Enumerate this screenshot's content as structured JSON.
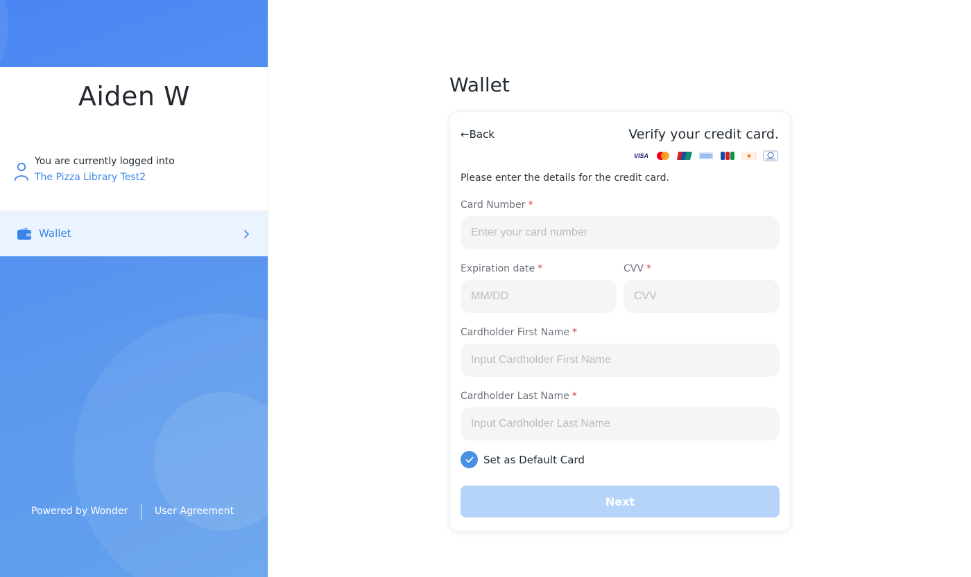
{
  "sidebar": {
    "user_name": "Aiden W",
    "logged_in_text": "You are currently logged into",
    "organization": "The Pizza Library Test2",
    "nav_items": [
      {
        "label": "Wallet",
        "icon": "wallet-icon",
        "active": true
      }
    ],
    "footer": {
      "powered_by": "Powered by Wonder",
      "user_agreement": "User Agreement"
    }
  },
  "main": {
    "title": "Wallet",
    "card": {
      "back_label": "Back",
      "heading": "Verify your credit card.",
      "card_brands": [
        {
          "name": "VISA",
          "color": "#1a1f71"
        },
        {
          "name": "mastercard",
          "color": "#eb001b"
        },
        {
          "name": "UnionPay",
          "color": "#d71e28"
        },
        {
          "name": "AMEX",
          "color": "#8fb0e6"
        },
        {
          "name": "JCB",
          "color": "#0b4ea2"
        },
        {
          "name": "DISCOVER",
          "color": "#f08a24"
        },
        {
          "name": "Diners Club",
          "color": "#2e5aa8"
        }
      ],
      "intro": "Please enter the details for the credit card.",
      "fields": {
        "card_number": {
          "label": "Card Number",
          "placeholder": "Enter your card number",
          "value": ""
        },
        "expiration": {
          "label": "Expiration date",
          "placeholder": "MM/DD",
          "value": ""
        },
        "cvv": {
          "label": "CVV",
          "placeholder": "CVV",
          "value": ""
        },
        "first_name": {
          "label": "Cardholder First Name",
          "placeholder": "Input Cardholder First Name",
          "value": ""
        },
        "last_name": {
          "label": "Cardholder Last Name",
          "placeholder": "Input Cardholder Last Name",
          "value": ""
        }
      },
      "required_marker": "*",
      "default_card": {
        "label": "Set as Default Card",
        "checked": true
      },
      "next_label": "Next"
    }
  },
  "colors": {
    "accent": "#3a86e8",
    "sidebar_gradient_start": "#4a86f3",
    "sidebar_gradient_end": "#63a2ec",
    "button_disabled": "#b6d3fa",
    "required": "#e03a3a"
  }
}
